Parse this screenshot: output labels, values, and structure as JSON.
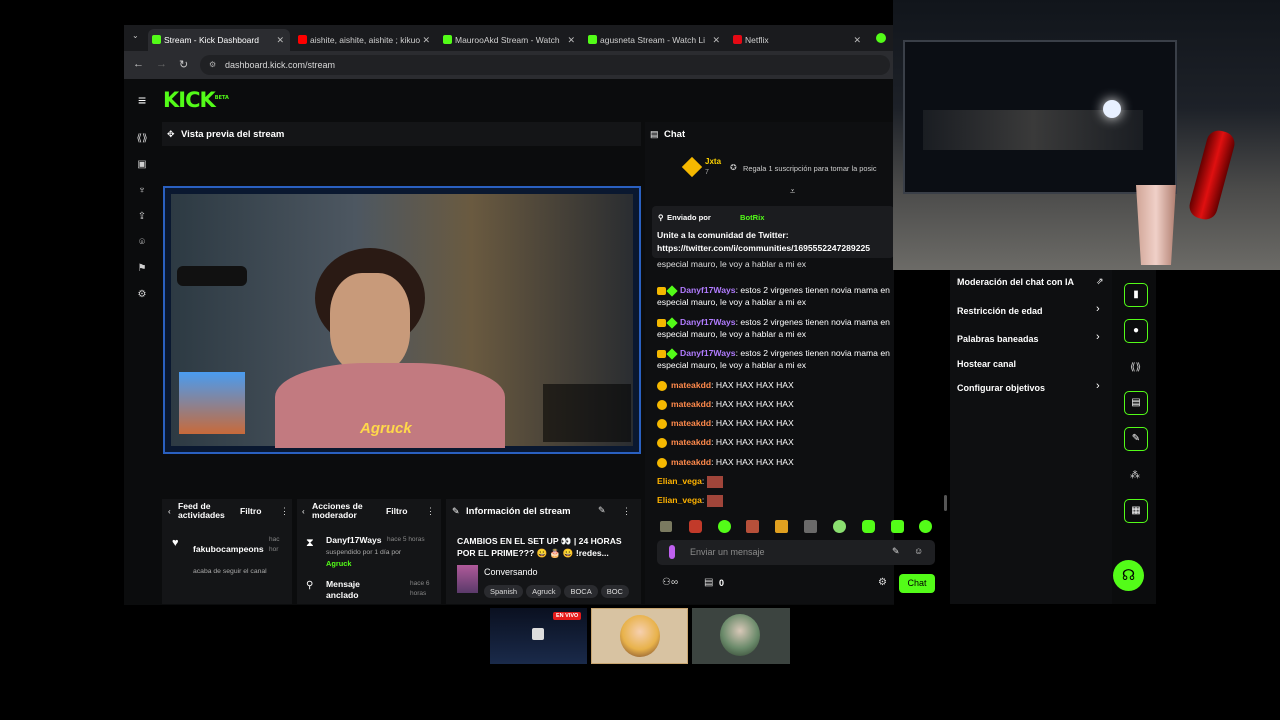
{
  "browser": {
    "tabs": [
      {
        "title": "Stream - Kick Dashboard",
        "color": "#53fc18"
      },
      {
        "title": "aishite, aishite, aishite ; kikuo",
        "color": "#ff0000"
      },
      {
        "title": "MaurooAkd Stream - Watch",
        "color": "#53fc18"
      },
      {
        "title": "agusneta Stream - Watch Li",
        "color": "#53fc18"
      },
      {
        "title": "Netflix",
        "color": "#e50914"
      }
    ],
    "url": "dashboard.kick.com/stream"
  },
  "app": {
    "logo": "KICK",
    "logo_sup": "BETA",
    "accent": "#53fc18"
  },
  "preview": {
    "header": "Vista previa del stream",
    "overlay_name": "Agruck"
  },
  "chat": {
    "header": "Chat",
    "top_user": "Jxta",
    "top_user_count": "7",
    "gift_prompt": "Regala 1 suscripción para tomar la posic",
    "pinned": {
      "sent_by_label": "Enviado por",
      "sender": "BotRix",
      "line1": "Unite a la comunidad de Twitter:",
      "line2": "https://twitter.com/i/communities/1695552247289225"
    },
    "messages": [
      {
        "user": "Danyf17Ways",
        "text": "estos 2 virgenes tienen novia mama en especial mauro, le voy a hablar a mi ex"
      },
      {
        "user": "Danyf17Ways",
        "text": "estos 2 virgenes tienen novia mama en especial mauro, le voy a hablar a mi ex"
      },
      {
        "user": "Danyf17Ways",
        "text": "estos 2 virgenes tienen novia mama en especial mauro, le voy a hablar a mi ex"
      },
      {
        "user": "mateakdd",
        "text": "HAX HAX HAX HAX"
      },
      {
        "user": "mateakdd",
        "text": "HAX HAX HAX HAX"
      },
      {
        "user": "mateakdd",
        "text": "HAX HAX HAX HAX"
      },
      {
        "user": "mateakdd",
        "text": "HAX HAX HAX HAX"
      },
      {
        "user": "mateakdd",
        "text": "HAX HAX HAX HAX"
      },
      {
        "user": "Elian_vega",
        "text": ""
      },
      {
        "user": "Elian_vega",
        "text": ""
      }
    ],
    "input_placeholder": "Enviar un mensaje",
    "send_label": "Chat",
    "viewer_count": "0"
  },
  "settings_menu": {
    "items": [
      {
        "label": "Moderación del chat con IA",
        "chevron": false
      },
      {
        "label": "Restricción de edad",
        "chevron": true
      },
      {
        "label": "Palabras baneadas",
        "chevron": true
      },
      {
        "label": "Hostear canal",
        "chevron": false
      },
      {
        "label": "Configurar objetivos",
        "chevron": true
      }
    ]
  },
  "activity_feed": {
    "title": "Feed de actividades",
    "filter": "Filtro",
    "item_user": "fakubocampeons",
    "item_time": "hac hor",
    "item_text": "acaba de seguir el canal"
  },
  "mod_actions": {
    "title": "Acciones de moderador",
    "filter": "Filtro",
    "item1_user": "Danyf17Ways",
    "item1_time": "hace 5 horas",
    "item1_text": "suspendido por 1 día por",
    "item1_mod": "Agruck",
    "item2_text": "Mensaje anclado",
    "item2_time": "hace 6 horas"
  },
  "stream_info": {
    "title": "Información del stream",
    "stream_title": "CAMBIOS EN EL SET UP 👀 | 24 HORAS POR EL PRIME??? 😀 🎂 😀 !redes...",
    "category": "Conversando",
    "tags": [
      "Spanish",
      "Agruck",
      "BOCA",
      "BOC"
    ]
  },
  "taskbar": {
    "live_label": "EN VIVO"
  }
}
